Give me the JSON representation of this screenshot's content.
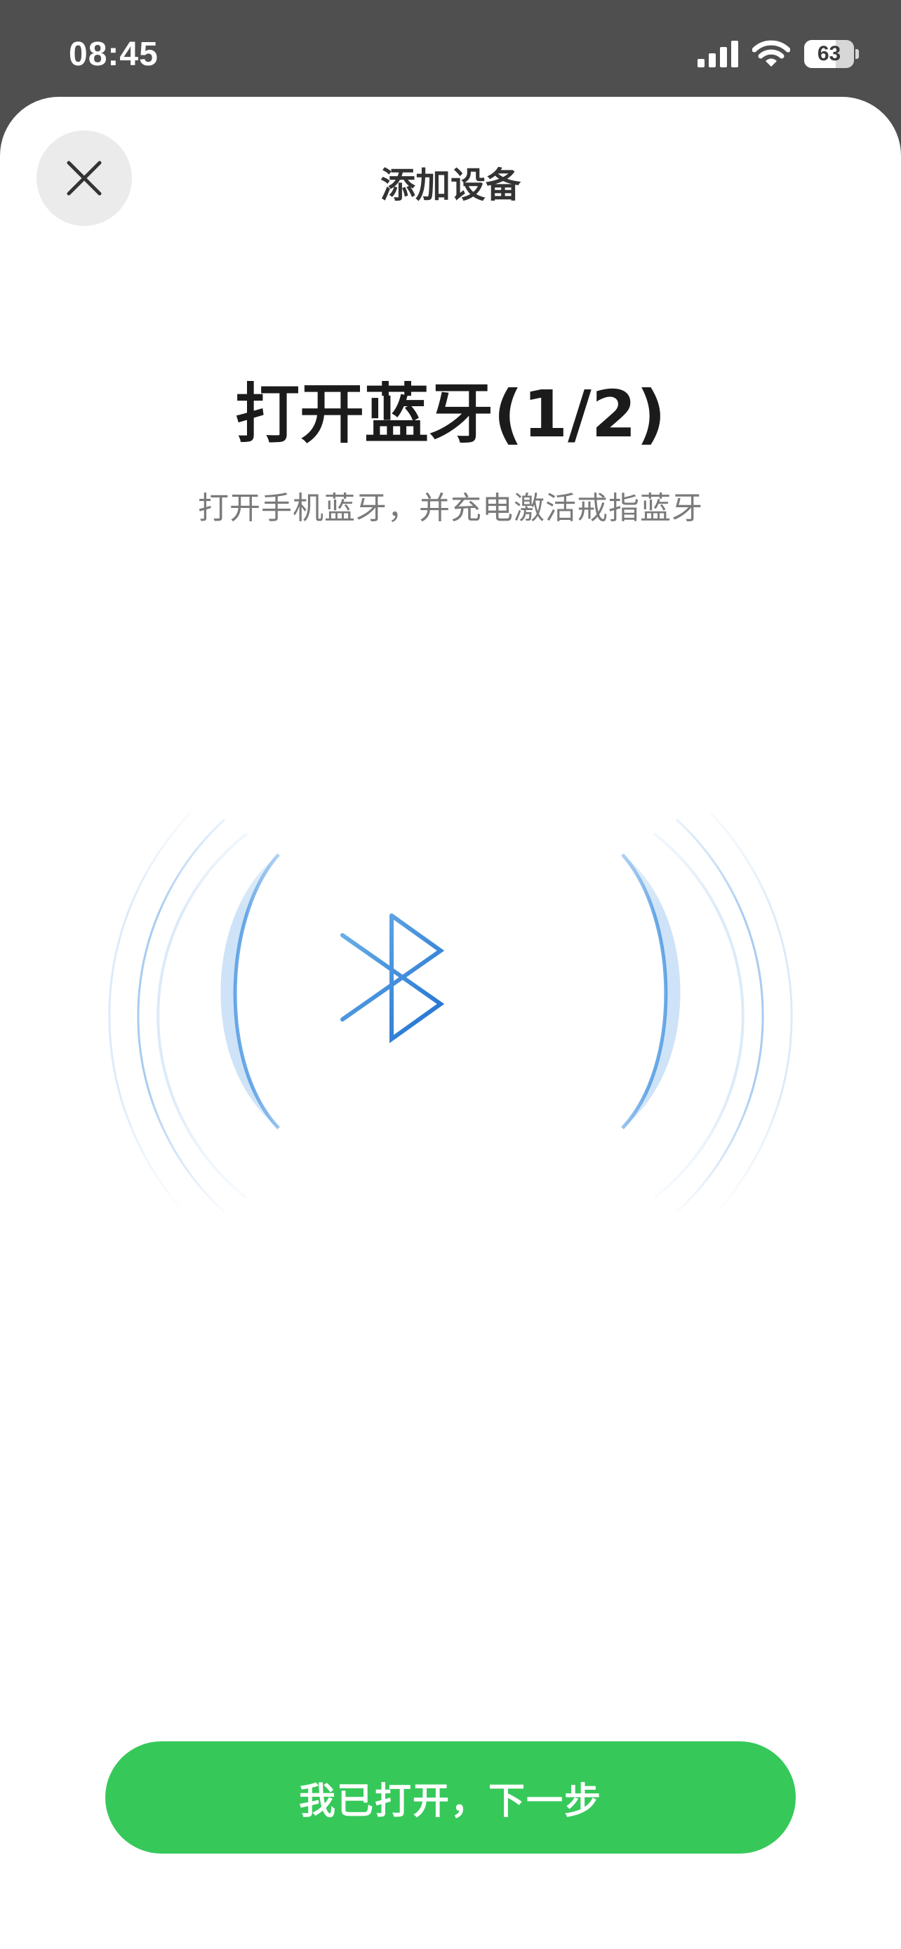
{
  "status_bar": {
    "time": "08:45",
    "battery_percent": 63,
    "icons": [
      "signal-icon",
      "wifi-icon",
      "battery-icon"
    ]
  },
  "header": {
    "title": "添加设备",
    "close_icon": "close-icon"
  },
  "step": {
    "title": "打开蓝牙(1/2)",
    "subtitle": "打开手机蓝牙，并充电激活戒指蓝牙"
  },
  "illustration": {
    "icon": "bluetooth-icon",
    "accent_color": "#3d8fe0"
  },
  "actions": {
    "next_label": "我已打开，下一步",
    "next_color": "#36c95a"
  }
}
